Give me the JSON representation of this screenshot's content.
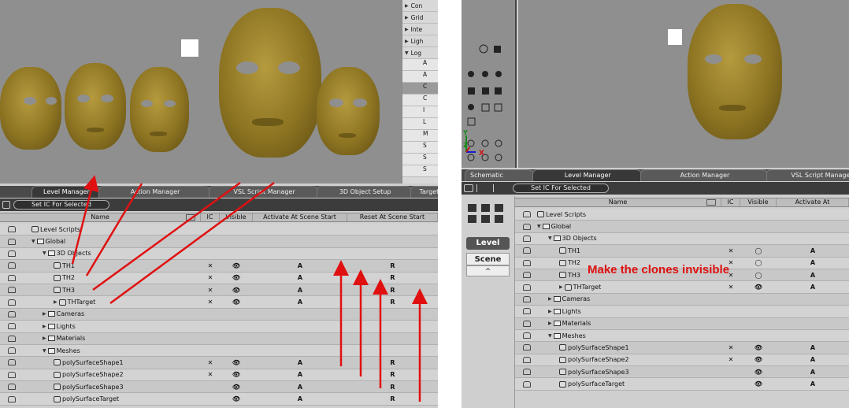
{
  "left": {
    "menu": [
      "Con",
      "Grid",
      "Inte",
      "Ligh",
      "Log"
    ],
    "menu_sub": [
      "A",
      "A",
      "C",
      "C",
      "I",
      "L",
      "M",
      "S",
      "S",
      "S"
    ],
    "tabs": [
      "Level Manager",
      "Action Manager",
      "VSL Script Manager",
      "3D Object Setup",
      "Target Can"
    ],
    "toolbar_button": "Set IC For Selected",
    "columns": [
      "Name",
      "IC",
      "Visible",
      "Activate At Scene Start",
      "Reset At Scene Start"
    ],
    "rows": [
      {
        "name": "Level Scripts",
        "indent": 0,
        "kind": "script",
        "ic": "",
        "vis": "",
        "act": "",
        "reset": ""
      },
      {
        "name": "Global",
        "indent": 0,
        "kind": "folder-open",
        "ic": "",
        "vis": "",
        "act": "",
        "reset": ""
      },
      {
        "name": "3D Objects",
        "indent": 1,
        "kind": "folder-open",
        "ic": "",
        "vis": "",
        "act": "",
        "reset": ""
      },
      {
        "name": "TH1",
        "indent": 2,
        "kind": "object",
        "ic": "✕",
        "vis": "👁",
        "act": "A",
        "reset": "R"
      },
      {
        "name": "TH2",
        "indent": 2,
        "kind": "object",
        "ic": "✕",
        "vis": "👁",
        "act": "A",
        "reset": "R"
      },
      {
        "name": "TH3",
        "indent": 2,
        "kind": "object",
        "ic": "✕",
        "vis": "👁",
        "act": "A",
        "reset": "R"
      },
      {
        "name": "THTarget",
        "indent": 2,
        "kind": "object-closed",
        "ic": "✕",
        "vis": "👁",
        "act": "A",
        "reset": "R"
      },
      {
        "name": "Cameras",
        "indent": 1,
        "kind": "folder-closed",
        "ic": "",
        "vis": "",
        "act": "",
        "reset": ""
      },
      {
        "name": "Lights",
        "indent": 1,
        "kind": "folder-closed",
        "ic": "",
        "vis": "",
        "act": "",
        "reset": ""
      },
      {
        "name": "Materials",
        "indent": 1,
        "kind": "folder-closed",
        "ic": "",
        "vis": "",
        "act": "",
        "reset": ""
      },
      {
        "name": "Meshes",
        "indent": 1,
        "kind": "folder-open",
        "ic": "",
        "vis": "",
        "act": "",
        "reset": ""
      },
      {
        "name": "polySurfaceShape1",
        "indent": 2,
        "kind": "mesh",
        "ic": "✕",
        "vis": "👁",
        "act": "A",
        "reset": "R"
      },
      {
        "name": "polySurfaceShape2",
        "indent": 2,
        "kind": "mesh",
        "ic": "✕",
        "vis": "👁",
        "act": "A",
        "reset": "R"
      },
      {
        "name": "polySurfaceShape3",
        "indent": 2,
        "kind": "mesh",
        "ic": "",
        "vis": "👁",
        "act": "A",
        "reset": "R"
      },
      {
        "name": "polySurfaceTarget",
        "indent": 2,
        "kind": "mesh",
        "ic": "",
        "vis": "👁",
        "act": "A",
        "reset": "R"
      }
    ]
  },
  "right": {
    "tabs": [
      "Schematic",
      "Level Manager",
      "Action Manager",
      "VSL Script Manager"
    ],
    "toolbar_button": "Set IC For Selected",
    "side_buttons": [
      "Level",
      "Scene",
      "^"
    ],
    "axis_labels": [
      "Y",
      "Z",
      "X"
    ],
    "columns": [
      "Name",
      "IC",
      "Visible",
      "Activate At"
    ],
    "annotation": "Make the clones invisible",
    "rows": [
      {
        "name": "Level Scripts",
        "indent": 0,
        "kind": "script",
        "ic": "",
        "vis": "",
        "act": ""
      },
      {
        "name": "Global",
        "indent": 0,
        "kind": "folder-open",
        "ic": "",
        "vis": "",
        "act": ""
      },
      {
        "name": "3D Objects",
        "indent": 1,
        "kind": "folder-open",
        "ic": "",
        "vis": "",
        "act": ""
      },
      {
        "name": "TH1",
        "indent": 2,
        "kind": "object",
        "ic": "✕",
        "vis": "◯",
        "act": "A"
      },
      {
        "name": "TH2",
        "indent": 2,
        "kind": "object",
        "ic": "✕",
        "vis": "◯",
        "act": "A"
      },
      {
        "name": "TH3",
        "indent": 2,
        "kind": "object",
        "ic": "✕",
        "vis": "◯",
        "act": "A"
      },
      {
        "name": "THTarget",
        "indent": 2,
        "kind": "object-closed",
        "ic": "✕",
        "vis": "👁",
        "act": "A"
      },
      {
        "name": "Cameras",
        "indent": 1,
        "kind": "folder-closed",
        "ic": "",
        "vis": "",
        "act": ""
      },
      {
        "name": "Lights",
        "indent": 1,
        "kind": "folder-closed",
        "ic": "",
        "vis": "",
        "act": ""
      },
      {
        "name": "Materials",
        "indent": 1,
        "kind": "folder-closed",
        "ic": "",
        "vis": "",
        "act": ""
      },
      {
        "name": "Meshes",
        "indent": 1,
        "kind": "folder-open",
        "ic": "",
        "vis": "",
        "act": ""
      },
      {
        "name": "polySurfaceShape1",
        "indent": 2,
        "kind": "mesh",
        "ic": "✕",
        "vis": "👁",
        "act": "A"
      },
      {
        "name": "polySurfaceShape2",
        "indent": 2,
        "kind": "mesh",
        "ic": "✕",
        "vis": "👁",
        "act": "A"
      },
      {
        "name": "polySurfaceShape3",
        "indent": 2,
        "kind": "mesh",
        "ic": "",
        "vis": "👁",
        "act": "A"
      },
      {
        "name": "polySurfaceTarget",
        "indent": 2,
        "kind": "mesh",
        "ic": "",
        "vis": "👁",
        "act": "A"
      }
    ]
  },
  "colors": {
    "annotation": "#e01010",
    "viewport": "#8f8f8f",
    "face": "#9b8128"
  }
}
